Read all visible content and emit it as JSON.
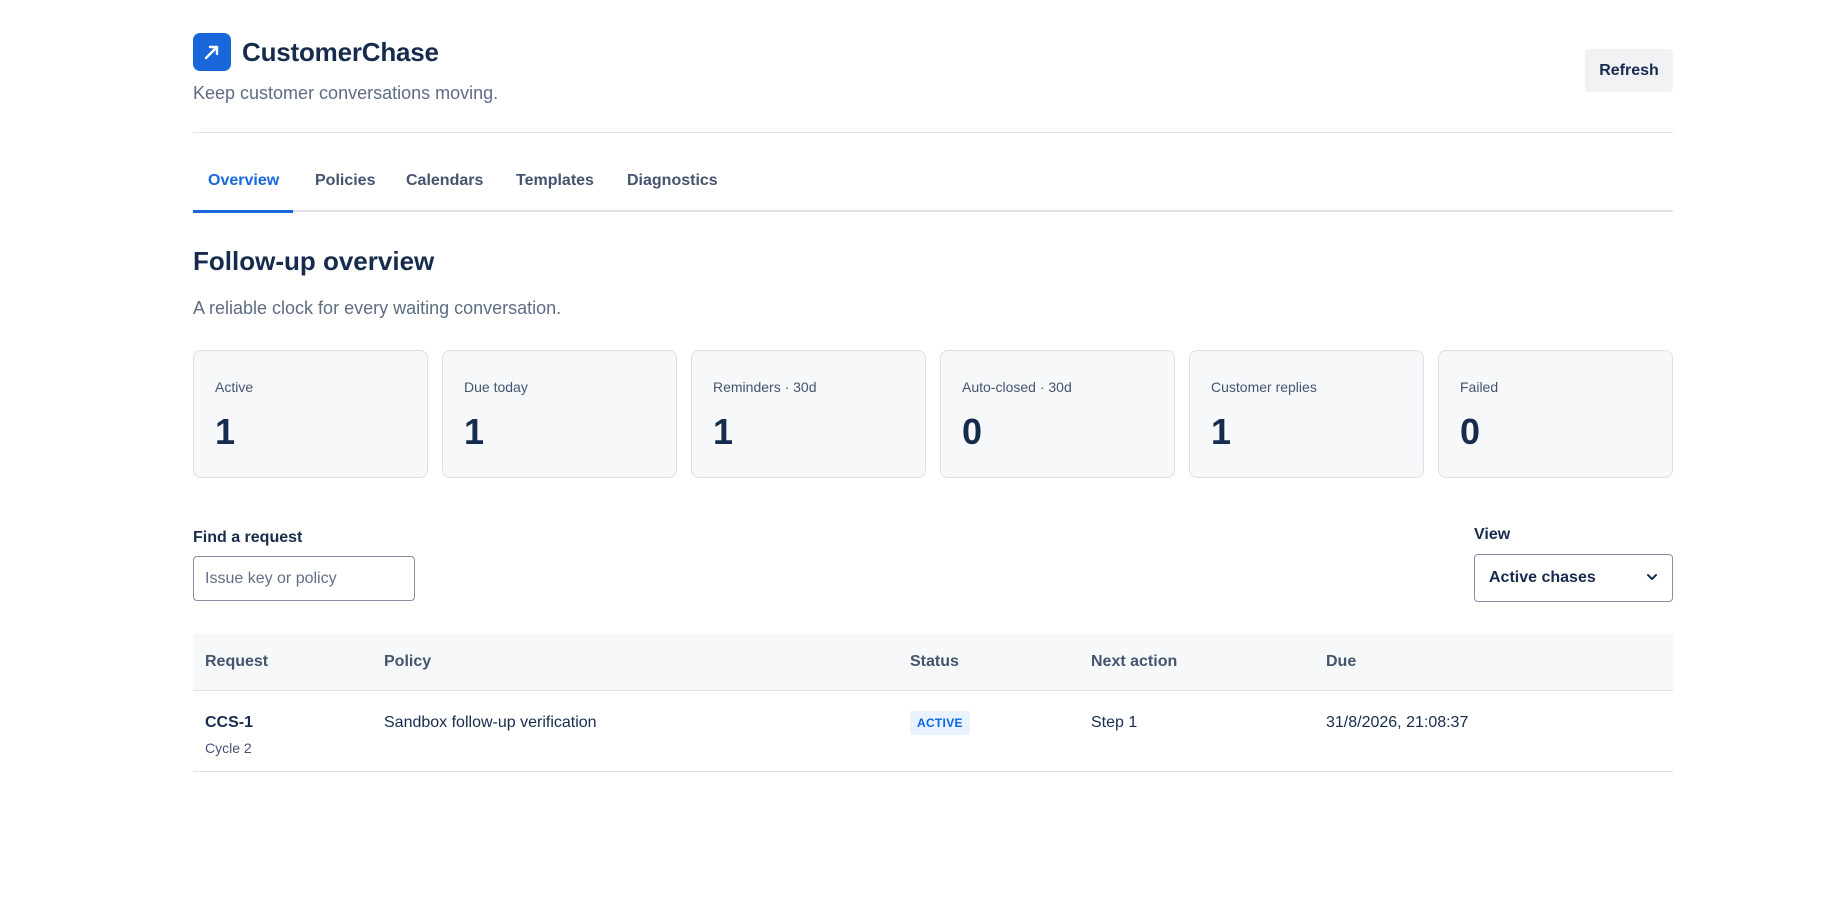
{
  "app": {
    "title": "CustomerChase",
    "subtitle": "Keep customer conversations moving.",
    "brand_color": "#1868db",
    "logo_icon": "arrow-up-right-icon"
  },
  "header": {
    "refresh_label": "Refresh"
  },
  "tabs": [
    {
      "label": "Overview",
      "active": true
    },
    {
      "label": "Policies",
      "active": false
    },
    {
      "label": "Calendars",
      "active": false
    },
    {
      "label": "Templates",
      "active": false
    },
    {
      "label": "Diagnostics",
      "active": false
    }
  ],
  "section": {
    "title": "Follow-up overview",
    "subtitle": "A reliable clock for every waiting conversation."
  },
  "stats": [
    {
      "label": "Active",
      "value": "1"
    },
    {
      "label": "Due today",
      "value": "1"
    },
    {
      "label": "Reminders · 30d",
      "value": "1"
    },
    {
      "label": "Auto-closed · 30d",
      "value": "0"
    },
    {
      "label": "Customer replies",
      "value": "1"
    },
    {
      "label": "Failed",
      "value": "0"
    }
  ],
  "filters": {
    "find_label": "Find a request",
    "search_placeholder": "Issue key or policy",
    "search_value": "",
    "view_label": "View",
    "view_selected": "Active chases"
  },
  "table": {
    "columns": [
      "Request",
      "Policy",
      "Status",
      "Next action",
      "Due"
    ],
    "rows": [
      {
        "request": "CCS-1",
        "cycle": "Cycle 2",
        "policy": "Sandbox follow-up verification",
        "status": "ACTIVE",
        "next_action": "Step 1",
        "due": "31/8/2026, 21:08:37"
      }
    ]
  }
}
